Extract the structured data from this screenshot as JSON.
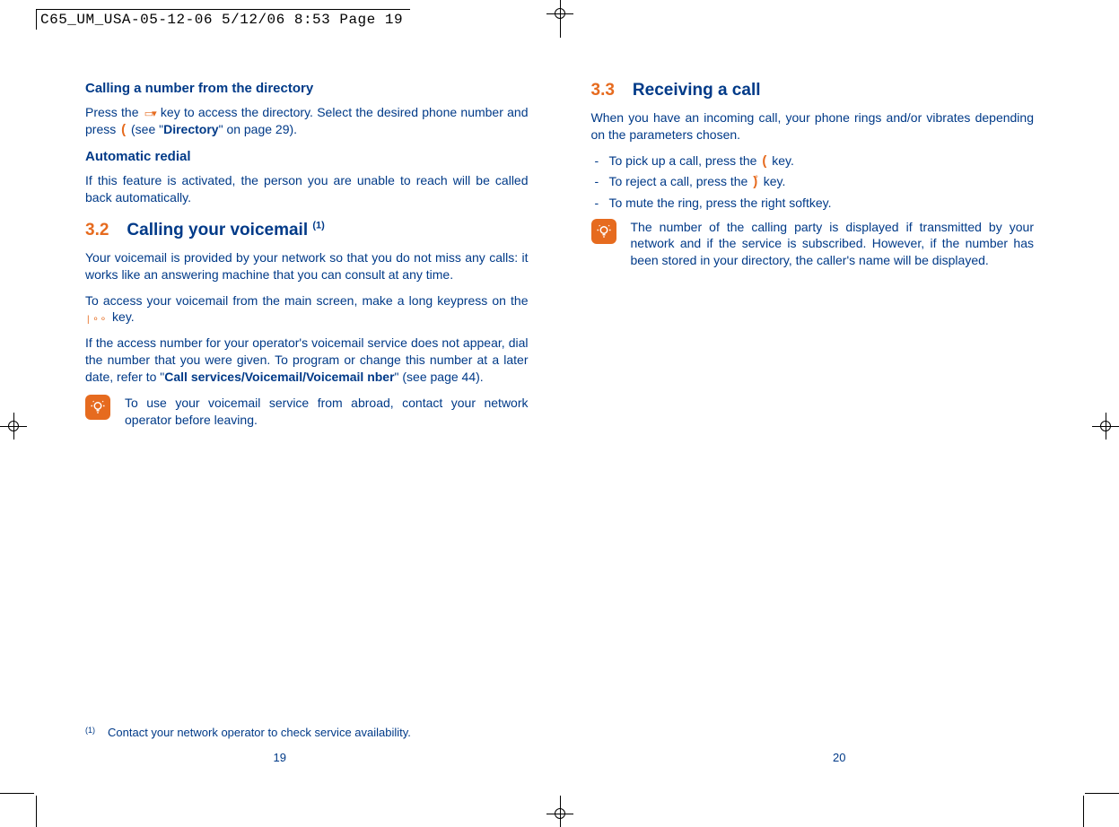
{
  "header": {
    "slug": "C65_UM_USA-05-12-06  5/12/06  8:53  Page 19"
  },
  "left": {
    "h1": "Calling a number from the directory",
    "p1a": "Press the ",
    "p1b": " key to access the directory. Select the desired phone number and press ",
    "p1c": " (see \"",
    "p1bold": "Directory",
    "p1d": "\" on page 29).",
    "h2": "Automatic redial",
    "p2": "If this feature is activated, the person you are unable to reach will be called back automatically.",
    "section_num": "3.2",
    "section_title": "Calling your voicemail ",
    "section_sup": "(1)",
    "p3": "Your voicemail is provided by your network so that you do not miss any calls: it works like an answering machine that you can consult at any time.",
    "p4a": "To access your voicemail from the main screen, make a long keypress on the ",
    "p4b": " key.",
    "p5a": "If the access number for your operator's voicemail service does not appear, dial the number that you were given. To program or change this number at a later date, refer to \"",
    "p5bold": "Call services/Voicemail/Voicemail nber",
    "p5b": "\" (see page 44).",
    "tip": "To use your voicemail service from abroad, contact your network operator before leaving.",
    "footnote_sup": "(1)",
    "footnote": "Contact your network operator to check service availability.",
    "page_num": "19"
  },
  "right": {
    "section_num": "3.3",
    "section_title": "Receiving a call",
    "p1": "When you have an incoming call, your phone rings and/or vibrates depending on the parameters chosen.",
    "li1a": "To pick up a call, press the ",
    "li1b": " key.",
    "li2a": "To reject a call, press the ",
    "li2b": " key.",
    "li3": "To mute the ring, press the right softkey.",
    "tip": "The number of the calling party is displayed if transmitted by your network and if the service is subscribed. However, if the number has been stored in your directory, the caller's name will be displayed.",
    "page_num": "20"
  }
}
